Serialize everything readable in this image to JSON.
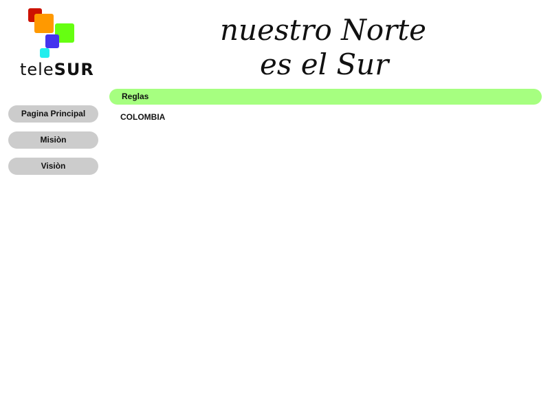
{
  "logo": {
    "text_light": "tele",
    "text_bold": "SUR",
    "colors": {
      "square_red": "#cc1100",
      "square_orange": "#ff9900",
      "square_green": "#66ff11",
      "square_blue": "#4433ee",
      "square_cyan": "#22eeee"
    }
  },
  "slogan": {
    "line1": "nuestro Norte",
    "line2": "es el Sur"
  },
  "sidebar": {
    "items": [
      {
        "label": "Pagina Principal"
      },
      {
        "label": "Misiòn"
      },
      {
        "label": "Visiòn"
      }
    ]
  },
  "main": {
    "section_title": "Reglas",
    "content": "COLOMBIA"
  },
  "colors": {
    "section_bar": "#a6ff80",
    "nav_button": "#cccccc"
  }
}
